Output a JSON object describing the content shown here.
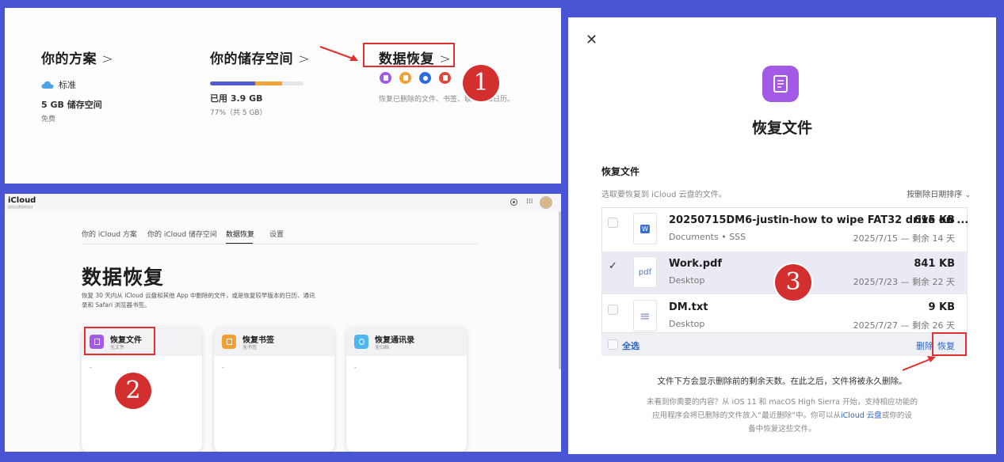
{
  "plan_panel": {
    "plan": {
      "title": "你的方案",
      "chevron": ">",
      "tier": "标准",
      "storage": "5 GB 储存空间",
      "price": "免费"
    },
    "storage": {
      "title": "你的储存空间",
      "chevron": ">",
      "used": "已用 3.9 GB",
      "detail": "77%（共 5 GB）",
      "used_fraction": 0.77
    },
    "recovery": {
      "title": "数据恢复",
      "chevron": ">",
      "description": "恢复已删除的文件、书签、联系人和日历。",
      "icon_names": [
        "file-icon",
        "bookmark-icon",
        "contact-icon",
        "calendar-icon"
      ],
      "icon_colors": [
        "#a259e6",
        "#f29e32",
        "#2d6cdf",
        "#e0463a"
      ]
    }
  },
  "annotations": {
    "step1": "1",
    "step2": "2",
    "step3": "3"
  },
  "icloud_page": {
    "brand": "iCloud",
    "brand_sub": "由无比漂亮的设计",
    "tabs": [
      "你的 iCloud 方案",
      "你的 iCloud 储存空间",
      "数据恢复",
      "设置"
    ],
    "heading": "数据恢复",
    "description_line1": "恢复 30 天内从 iCloud 云盘和其他 App 中删除的文件，或是恢复较早版本的日历、通讯",
    "description_line2": "录和 Safari 浏览器书签。",
    "cards": [
      {
        "title": "恢复文件",
        "sub": "无文件",
        "dash": "-",
        "color": "#a259e6",
        "icon": "file-icon"
      },
      {
        "title": "恢复书签",
        "sub": "无书签",
        "dash": "-",
        "color": "#f29e32",
        "icon": "bookmark-icon"
      },
      {
        "title": "恢复通讯录",
        "sub": "无归档",
        "dash": "-",
        "color": "#4fb7f0",
        "icon": "contact-icon"
      }
    ]
  },
  "restore_dialog": {
    "close": "✕",
    "title": "恢复文件",
    "section_title": "恢复文件",
    "instruction": "选取要恢复到 iCloud 云盘的文件。",
    "sort": "按删除日期排序",
    "files": [
      {
        "name": "20250715DM6-justin-how to wipe FAT32 drive on ...",
        "size": "615 KB",
        "location": "Documents • SSS",
        "date": "2025/7/15 — 剩余 14 天",
        "icon": "W",
        "selected": false
      },
      {
        "name": "Work.pdf",
        "size": "841 KB",
        "location": "Desktop",
        "date": "2025/7/23 — 剩余 22 天",
        "icon": "pdf",
        "selected": true
      },
      {
        "name": "DM.txt",
        "size": "9 KB",
        "location": "Desktop",
        "date": "2025/7/27 — 剩余 26 天",
        "icon": "≡",
        "selected": false
      }
    ],
    "select_all": "全选",
    "delete": "删除",
    "restore": "恢复",
    "note": "文件下方会显示删除前的剩余天数。在此之后，文件将被永久删除。",
    "help_line1": "未看到你需要的内容？从 iOS 11 和 macOS High Sierra 开始，支持相应功能的",
    "help_line2": "应用程序会将已删除的文件放入“最近删除”中。你可以从",
    "help_link": "iCloud 云盘",
    "help_line2_end": "或你的设",
    "help_line3": "备中恢复这些文件。"
  }
}
